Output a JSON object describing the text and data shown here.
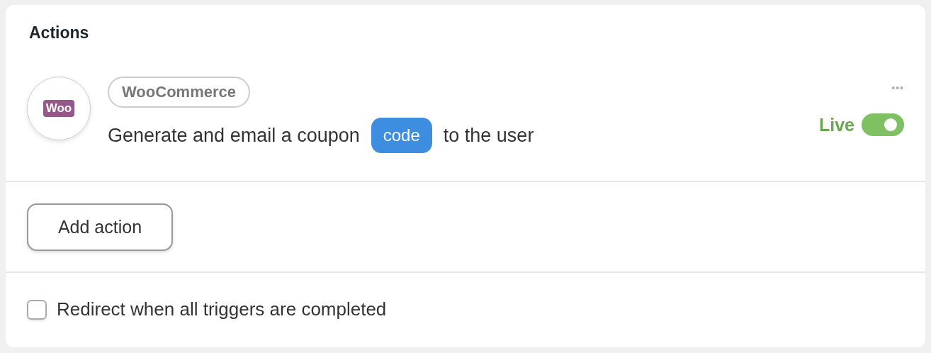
{
  "section": {
    "title": "Actions"
  },
  "actions": [
    {
      "logo_text": "Woo",
      "app": "WooCommerce",
      "parts": [
        {
          "kind": "text",
          "text": "Generate and email a coupon"
        },
        {
          "kind": "token",
          "text": "code"
        },
        {
          "kind": "text",
          "text": "to the user"
        }
      ],
      "more": "•••",
      "status": "Live",
      "on": true
    }
  ],
  "add_button": "Add action",
  "redirect": {
    "label": "Redirect when all triggers are completed",
    "checked": false
  }
}
